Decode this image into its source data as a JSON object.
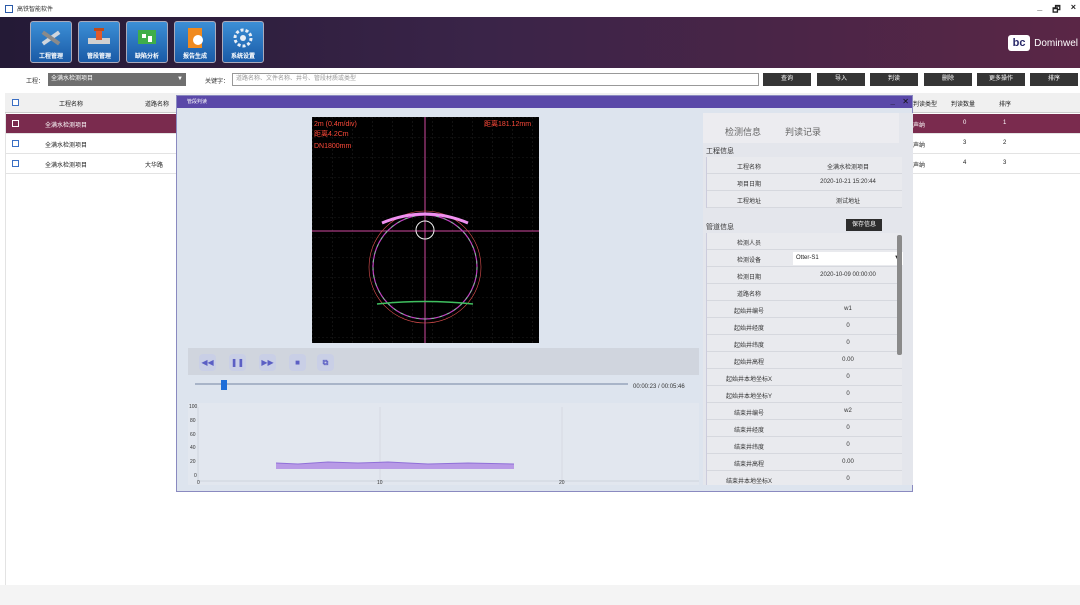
{
  "window": {
    "title": "高铁智能软件",
    "controls": [
      "_",
      "🗗",
      "×"
    ]
  },
  "toolbar": {
    "tools": [
      {
        "label": "工程管理",
        "icon": "tools-icon"
      },
      {
        "label": "管段管理",
        "icon": "pipe-valve-icon"
      },
      {
        "label": "缺陷分析",
        "icon": "defect-analysis-icon"
      },
      {
        "label": "报告生成",
        "icon": "report-icon"
      },
      {
        "label": "系统设置",
        "icon": "gear-icon"
      }
    ],
    "brand": {
      "logo": "bc",
      "name": "Dominwel"
    }
  },
  "search": {
    "project_label": "工程：",
    "project_value": "全满水检测项目",
    "keyword_label": "关键字：",
    "keyword_placeholder": "道路名称、文件名称、井号、管段材质或类型",
    "buttons": [
      "查询",
      "导入",
      "判读",
      "删除",
      "更多操作",
      "排序"
    ]
  },
  "table": {
    "headers": [
      "工程名称",
      "道路名称",
      "判读类型",
      "判读数量",
      "排序"
    ],
    "rows": [
      {
        "name": "全满水检测项目",
        "road": "",
        "type": "声纳",
        "count": "0",
        "order": "1",
        "selected": true
      },
      {
        "name": "全满水检测项目",
        "road": "",
        "type": "声纳",
        "count": "3",
        "order": "2",
        "selected": false
      },
      {
        "name": "全满水检测项目",
        "road": "大华路",
        "type": "声纳",
        "count": "4",
        "order": "3",
        "selected": false
      }
    ]
  },
  "dialog": {
    "title": "管段判读",
    "minimize": "_",
    "close": "✕",
    "scope": {
      "line1": "2m (0.4m/div)",
      "line2": "距离4.2Cm",
      "line3": "DN1800mm",
      "corner": "距离181.12mm"
    },
    "playback": {
      "buttons": [
        "◀◀",
        "❚❚",
        "▶▶",
        "■",
        "⧉"
      ],
      "time": "00:00:23 / 00:05:46",
      "progress": 0.066
    },
    "graph": {
      "y_ticks": [
        "100",
        "80",
        "60",
        "40",
        "20",
        "0"
      ],
      "x_ticks": [
        "0",
        "10",
        "20"
      ]
    },
    "info": {
      "tabs": [
        "检测信息",
        "判读记录"
      ],
      "project_section": "工程信息",
      "project_fields": [
        {
          "k": "工程名称",
          "v": "全满水检测项目"
        },
        {
          "k": "项目日期",
          "v": "2020-10-21 15:20:44"
        },
        {
          "k": "工程地址",
          "v": "测试地址"
        }
      ],
      "pipe_section": "管道信息",
      "save_label": "保存信息",
      "pipe_fields": [
        {
          "k": "检测人员",
          "v": ""
        },
        {
          "k": "检测设备",
          "v": "Otter-S1",
          "select": true
        },
        {
          "k": "检测日期",
          "v": "2020-10-09 00:00:00"
        },
        {
          "k": "道路名称",
          "v": ""
        },
        {
          "k": "起始井编号",
          "v": "w1"
        },
        {
          "k": "起始井经度",
          "v": "0"
        },
        {
          "k": "起始井纬度",
          "v": "0"
        },
        {
          "k": "起始井高程",
          "v": "0.00"
        },
        {
          "k": "起始井本地坐标X",
          "v": "0"
        },
        {
          "k": "起始井本地坐标Y",
          "v": "0"
        },
        {
          "k": "结束井编号",
          "v": "w2"
        },
        {
          "k": "结束井经度",
          "v": "0"
        },
        {
          "k": "结束井纬度",
          "v": "0"
        },
        {
          "k": "结束井高程",
          "v": "0.00"
        },
        {
          "k": "结束井本地坐标X",
          "v": "0"
        }
      ]
    }
  }
}
